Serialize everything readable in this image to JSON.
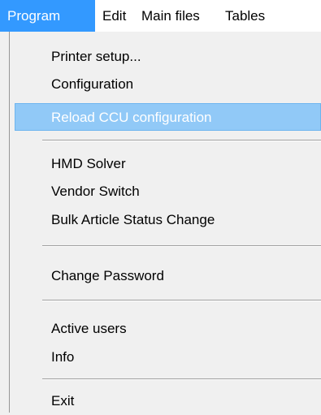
{
  "menubar": {
    "items": [
      {
        "label": "Program"
      },
      {
        "label": "Edit"
      },
      {
        "label": "Main files"
      },
      {
        "label": "Tables"
      }
    ]
  },
  "program_menu": {
    "items": [
      {
        "label": "Printer setup..."
      },
      {
        "label": "Configuration"
      },
      {
        "label": "Reload CCU configuration"
      },
      {
        "label": "HMD Solver"
      },
      {
        "label": "Vendor Switch"
      },
      {
        "label": "Bulk Article Status Change"
      },
      {
        "label": "Change Password"
      },
      {
        "label": "Active users"
      },
      {
        "label": "Info"
      },
      {
        "label": "Exit"
      }
    ],
    "highlighted_item": "Reload CCU configuration"
  }
}
